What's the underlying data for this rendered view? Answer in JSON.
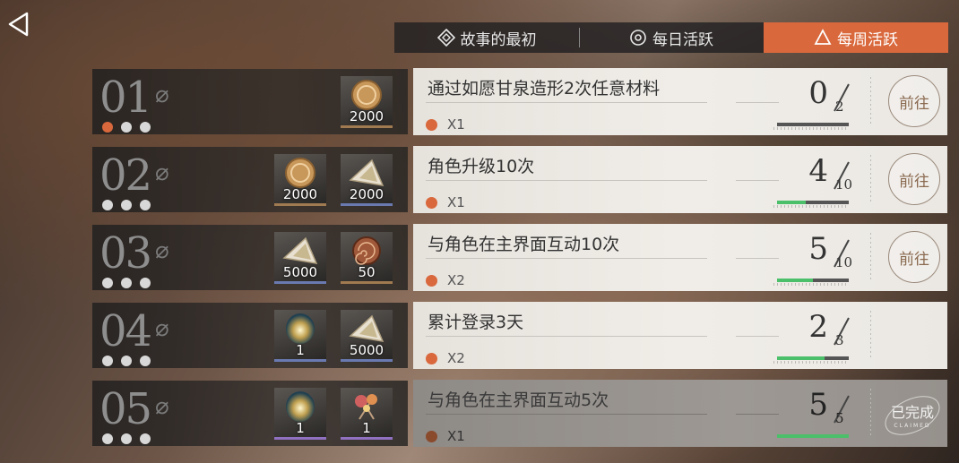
{
  "tabs": [
    {
      "label": "故事的最初",
      "icon": "diamond-icon",
      "active": false
    },
    {
      "label": "每日活跃",
      "icon": "circle-target-icon",
      "active": false
    },
    {
      "label": "每周活跃",
      "icon": "triangle-icon",
      "active": true
    }
  ],
  "accent_color": "#d9683c",
  "progress_color": "#4bbf6a",
  "rows": [
    {
      "num": "01",
      "dots_active": 1,
      "rewards": [
        {
          "icon": "gold-coin-icon",
          "value": "2000"
        }
      ],
      "title": "通过如愿甘泉造形2次任意材料",
      "multiplier": "X1",
      "current": "0",
      "total": "2",
      "progress": 0.0,
      "action": "前往"
    },
    {
      "num": "02",
      "dots_active": 0,
      "rewards": [
        {
          "icon": "gold-coin-icon",
          "value": "2000"
        },
        {
          "icon": "crystal-shard-icon",
          "value": "2000"
        }
      ],
      "title": "角色升级10次",
      "multiplier": "X1",
      "current": "4",
      "total": "10",
      "progress": 0.4,
      "action": "前往"
    },
    {
      "num": "03",
      "dots_active": 0,
      "rewards": [
        {
          "icon": "crystal-shard-icon",
          "value": "5000"
        },
        {
          "icon": "ammonite-shell-icon",
          "value": "50"
        }
      ],
      "title": "与角色在主界面互动10次",
      "multiplier": "X2",
      "current": "5",
      "total": "10",
      "progress": 0.5,
      "action": "前往"
    },
    {
      "num": "04",
      "dots_active": 0,
      "rewards": [
        {
          "icon": "glowing-orb-icon",
          "value": "1"
        },
        {
          "icon": "crystal-shard-icon",
          "value": "5000"
        }
      ],
      "title": "累计登录3天",
      "multiplier": "X2",
      "current": "2",
      "total": "3",
      "progress": 0.667,
      "action": ""
    },
    {
      "num": "05",
      "dots_active": 0,
      "rewards": [
        {
          "icon": "glowing-orb-icon",
          "value": "1"
        },
        {
          "icon": "flower-charm-icon",
          "value": "1"
        }
      ],
      "title": "与角色在主界面互动5次",
      "multiplier": "X1",
      "current": "5",
      "total": "5",
      "progress": 1.0,
      "claimed_label": "已完成",
      "claimed_sub": "CLAIMED"
    }
  ]
}
